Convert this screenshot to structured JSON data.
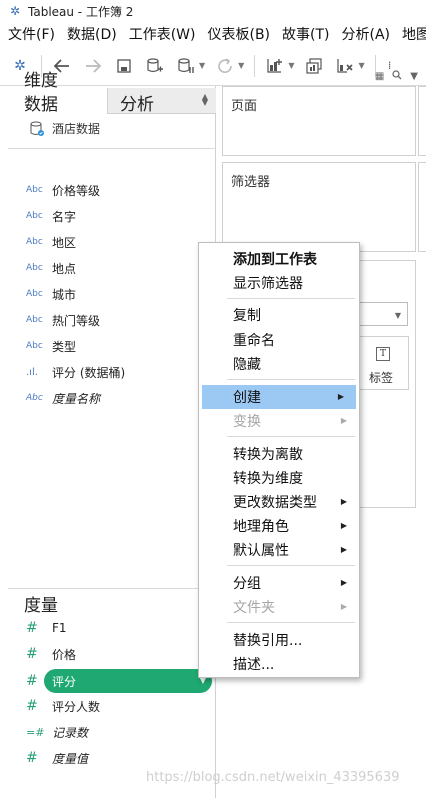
{
  "window": {
    "title": "Tableau - 工作簿 2",
    "logo_icon": "tableau-logo-icon"
  },
  "menubar": {
    "items": [
      "文件(F)",
      "数据(D)",
      "工作表(W)",
      "仪表板(B)",
      "故事(T)",
      "分析(A)",
      "地图(M)"
    ]
  },
  "toolbar": {
    "buttons": [
      "tableau-home-icon",
      "undo-icon",
      "redo-icon",
      "save-icon",
      "new-datasource-icon",
      "pause-updates-icon",
      "refresh-icon",
      "new-worksheet-icon",
      "duplicate-sheet-icon",
      "clear-sheet-icon",
      "more-icon"
    ]
  },
  "data_pane": {
    "tab_data": "数据",
    "tab_analysis": "分析",
    "datasource": "酒店数据",
    "dimensions_header": "维度",
    "dimensions": [
      {
        "type": "Abc",
        "label": "价格等级",
        "italic": false
      },
      {
        "type": "Abc",
        "label": "名字",
        "italic": false
      },
      {
        "type": "Abc",
        "label": "地区",
        "italic": false
      },
      {
        "type": "Abc",
        "label": "地点",
        "italic": false
      },
      {
        "type": "Abc",
        "label": "城市",
        "italic": false
      },
      {
        "type": "Abc",
        "label": "热门等级",
        "italic": false
      },
      {
        "type": "Abc",
        "label": "类型",
        "italic": false
      },
      {
        "type": ".ıl.",
        "label": "评分 (数据桶)",
        "italic": false
      },
      {
        "type": "Abc",
        "label": "度量名称",
        "italic": true
      }
    ],
    "measures_header": "度量",
    "measures": [
      {
        "type": "#",
        "label": "F1",
        "italic": false
      },
      {
        "type": "#",
        "label": "价格",
        "italic": false
      },
      {
        "type": "#",
        "label": "评分",
        "italic": false,
        "selected": true
      },
      {
        "type": "#",
        "label": "评分人数",
        "italic": false
      },
      {
        "type": "=#",
        "label": "记录数",
        "italic": true
      },
      {
        "type": "#",
        "label": "度量值",
        "italic": true
      }
    ],
    "selected_color": "#1fa872"
  },
  "shelves": {
    "pages": "页面",
    "filters": "筛选器",
    "label_button": "标签"
  },
  "context_menu": {
    "highlight_color": "#9cc9f3",
    "items": [
      {
        "label": "添加到工作表",
        "bold": true
      },
      {
        "label": "显示筛选器"
      },
      {
        "separator": true
      },
      {
        "label": "复制"
      },
      {
        "label": "重命名"
      },
      {
        "label": "隐藏"
      },
      {
        "separator": true
      },
      {
        "label": "创建",
        "submenu": true,
        "highlighted": true
      },
      {
        "label": "变换",
        "submenu": true,
        "disabled": true
      },
      {
        "separator": true
      },
      {
        "label": "转换为离散"
      },
      {
        "label": "转换为维度"
      },
      {
        "label": "更改数据类型",
        "submenu": true
      },
      {
        "label": "地理角色",
        "submenu": true
      },
      {
        "label": "默认属性",
        "submenu": true
      },
      {
        "separator": true
      },
      {
        "label": "分组",
        "submenu": true
      },
      {
        "label": "文件夹",
        "submenu": true,
        "disabled": true
      },
      {
        "separator": true
      },
      {
        "label": "替换引用..."
      },
      {
        "label": "描述..."
      }
    ]
  },
  "watermark": "https://blog.csdn.net/weixin_43395639"
}
